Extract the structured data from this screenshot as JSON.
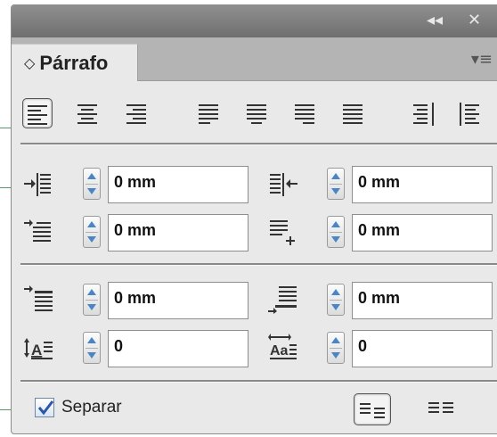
{
  "panel": {
    "title": "Párrafo",
    "tab_arrows": "◇",
    "collapse_glyph": "◂◂",
    "close_glyph": "✕",
    "menu_glyph": "▾≡"
  },
  "alignment": {
    "buttons": [
      {
        "icon": "align-left-icon",
        "selected": true
      },
      {
        "icon": "align-center-icon",
        "selected": false
      },
      {
        "icon": "align-right-icon",
        "selected": false
      },
      {
        "icon": "justify-left-icon",
        "selected": false
      },
      {
        "icon": "justify-center-icon",
        "selected": false
      },
      {
        "icon": "justify-right-icon",
        "selected": false
      },
      {
        "icon": "justify-all-icon",
        "selected": false
      },
      {
        "icon": "align-toward-spine-icon",
        "selected": false
      },
      {
        "icon": "align-away-from-spine-icon",
        "selected": false
      }
    ]
  },
  "fields": {
    "left_indent": "0 mm",
    "right_indent": "0 mm",
    "first_line_indent": "0 mm",
    "last_line_right_indent": "0 mm",
    "space_before": "0 mm",
    "space_after": "0 mm",
    "drop_cap_lines": "0",
    "drop_cap_chars": "0"
  },
  "hyphenate": {
    "label": "Separar",
    "checked": true
  },
  "colors": {
    "spin_arrow": "#4a86c4",
    "titlebar": "#7f7f7f",
    "panel_bg": "#e9e9e9",
    "leader_line": "#5a9a6a"
  }
}
